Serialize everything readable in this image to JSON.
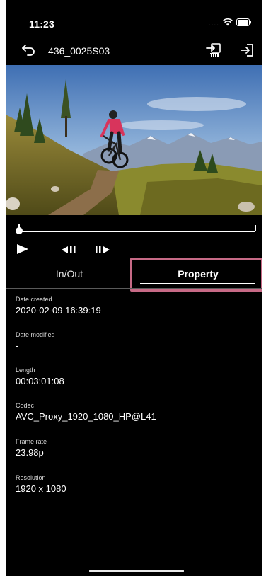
{
  "status_bar": {
    "time": "11:23",
    "signal": "...."
  },
  "nav": {
    "title": "436_0025S03"
  },
  "tabs": {
    "in_out": "In/Out",
    "property": "Property"
  },
  "properties": [
    {
      "label": "Date created",
      "value": "2020-02-09 16:39:19"
    },
    {
      "label": "Date modified",
      "value": "-"
    },
    {
      "label": "Length",
      "value": "00:03:01:08"
    },
    {
      "label": "Codec",
      "value": "AVC_Proxy_1920_1080_HP@L41"
    },
    {
      "label": "Frame rate",
      "value": "23.98p"
    },
    {
      "label": "Resolution",
      "value": "1920 x 1080"
    }
  ],
  "playback": {
    "position": 0
  },
  "colors": {
    "background": "#000000",
    "highlight": "#c76a86",
    "text": "#ffffff"
  },
  "icons": [
    "back-icon",
    "export-icon",
    "logout-icon",
    "play-icon",
    "frame-back-icon",
    "frame-forward-icon",
    "wifi-icon",
    "battery-icon"
  ]
}
